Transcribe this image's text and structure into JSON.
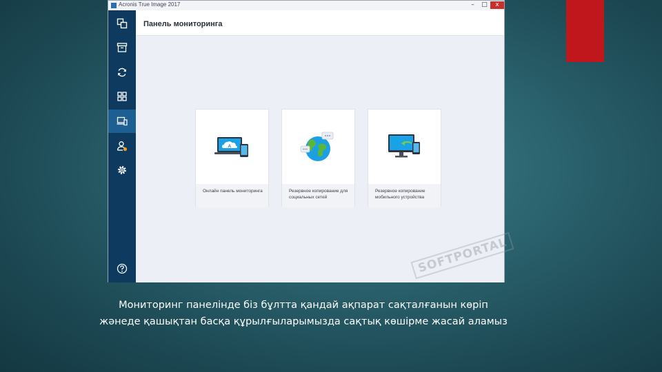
{
  "window": {
    "title": "Acronis True Image 2017",
    "controls": [
      "–",
      "□",
      "x"
    ]
  },
  "sidebar": {
    "items": [
      {
        "icon": "copy-icon",
        "active": false
      },
      {
        "icon": "archive-icon",
        "active": false
      },
      {
        "icon": "sync-icon",
        "active": false
      },
      {
        "icon": "tools-grid-icon",
        "active": false
      },
      {
        "icon": "dashboard-devices-icon",
        "active": true
      },
      {
        "icon": "account-icon",
        "active": false
      },
      {
        "icon": "settings-gear-icon",
        "active": false
      }
    ],
    "help_icon": "help-icon"
  },
  "main": {
    "title": "Панель мониторинга",
    "cards": [
      {
        "icon": "cloud-laptop-icon",
        "label": "Онлайн панель мониторинга"
      },
      {
        "icon": "globe-social-icon",
        "label": "Резервное копирование для социальных сетей"
      },
      {
        "icon": "monitor-mobile-icon",
        "label": "Резервное копирование мобильного устройства"
      }
    ]
  },
  "watermark": "SOFTPORTAL",
  "caption": {
    "line1": "Мониторинг панелінде біз бұлтта қандай ақпарат сақталғанын көріп",
    "line2": "жәнеде қашықтан басқа құрылғыларымызда сақтық көшірме жасай аламыз"
  },
  "colors": {
    "sidebar": "#0d3a5e",
    "sidebar_active": "#1d5f92",
    "accent_red": "#c0171c",
    "background": "#2c6570"
  }
}
